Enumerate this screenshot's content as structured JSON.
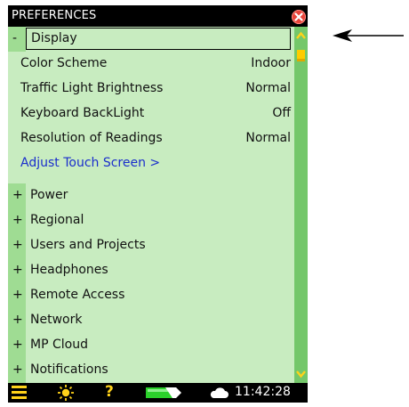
{
  "window": {
    "title": "PREFERENCES"
  },
  "groups": {
    "display": {
      "toggle": "-",
      "label": "Display"
    },
    "power": {
      "toggle": "+",
      "label": "Power"
    },
    "regional": {
      "toggle": "+",
      "label": "Regional"
    },
    "users": {
      "toggle": "+",
      "label": "Users and Projects"
    },
    "headphones": {
      "toggle": "+",
      "label": "Headphones"
    },
    "remote": {
      "toggle": "+",
      "label": "Remote Access"
    },
    "network": {
      "toggle": "+",
      "label": "Network"
    },
    "cloud": {
      "toggle": "+",
      "label": "MP Cloud"
    },
    "notifications": {
      "toggle": "+",
      "label": "Notifications"
    }
  },
  "display_settings": {
    "color_scheme": {
      "label": "Color Scheme",
      "value": "Indoor"
    },
    "traffic_light": {
      "label": "Traffic Light Brightness",
      "value": "Normal"
    },
    "keyboard_backlight": {
      "label": "Keyboard BackLight",
      "value": "Off"
    },
    "resolution": {
      "label": "Resolution of Readings",
      "value": "Normal"
    },
    "touch_link": {
      "label": "Adjust Touch Screen >"
    }
  },
  "status_bar": {
    "time": "11:42:28",
    "icons": [
      "menu-icon",
      "brightness-icon",
      "help-icon",
      "battery-icon",
      "cloud-icon"
    ]
  },
  "colors": {
    "list_bg": "#c8ecc0",
    "toggle_col": "#9fdc93",
    "scrollbar": "#74c76a",
    "accent": "#ffd21a",
    "link": "#1a2ecc",
    "close": "#e8443a"
  }
}
